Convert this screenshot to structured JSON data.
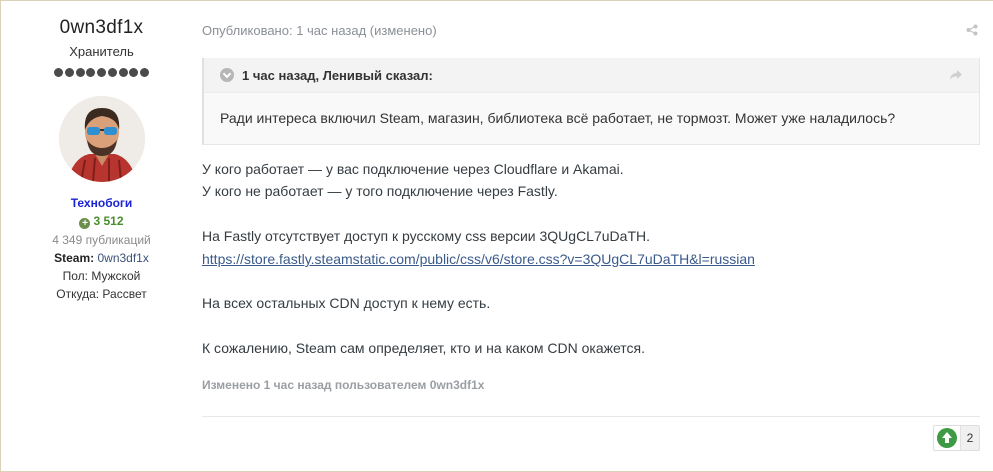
{
  "author": {
    "username": "0wn3df1x",
    "rank": "Хранитель",
    "rank_pips": 9,
    "group": "Технобоги",
    "reputation": "3 512",
    "posts": "4 349 публикаций",
    "steam_label": "Steam:",
    "steam_value": "0wn3df1x",
    "gender": "Пол: Мужской",
    "location": "Откуда: Рассвет"
  },
  "post": {
    "meta": "Опубликовано: 1 час назад (изменено)",
    "quote": {
      "author": "1 час назад, Ленивый сказал:",
      "text": "Ради интереса включил Steam, магазин, библиотека всё работает, не тормозт. Может уже наладилось?"
    },
    "paragraphs": [
      "У кого работает — у вас подключение через Cloudflare и Akamai.",
      "У кого не работает — у того подключение через Fastly.",
      "На Fastly отсутствует доступ к русскому css версии 3QUgCL7uDaTH.",
      "На всех остальных CDN доступ к нему есть.",
      "К сожалению, Steam сам определяет, кто и на каком CDN окажется."
    ],
    "link": "https://store.fastly.steamstatic.com/public/css/v6/store.css?v=3QUgCL7uDaTH&l=russian",
    "edited": "Изменено 1 час назад пользователем 0wn3df1x",
    "reaction_count": "2"
  },
  "icons": {
    "share": "share-icon",
    "quote_jump": "share-arrow-icon",
    "quote_toggle": "chevron-down-icon",
    "reaction": "upvote-icon",
    "rep": "plus-icon"
  },
  "colors": {
    "group": "#1a22d6",
    "reputation": "#4a8d2d",
    "link": "#3a5a8a"
  }
}
